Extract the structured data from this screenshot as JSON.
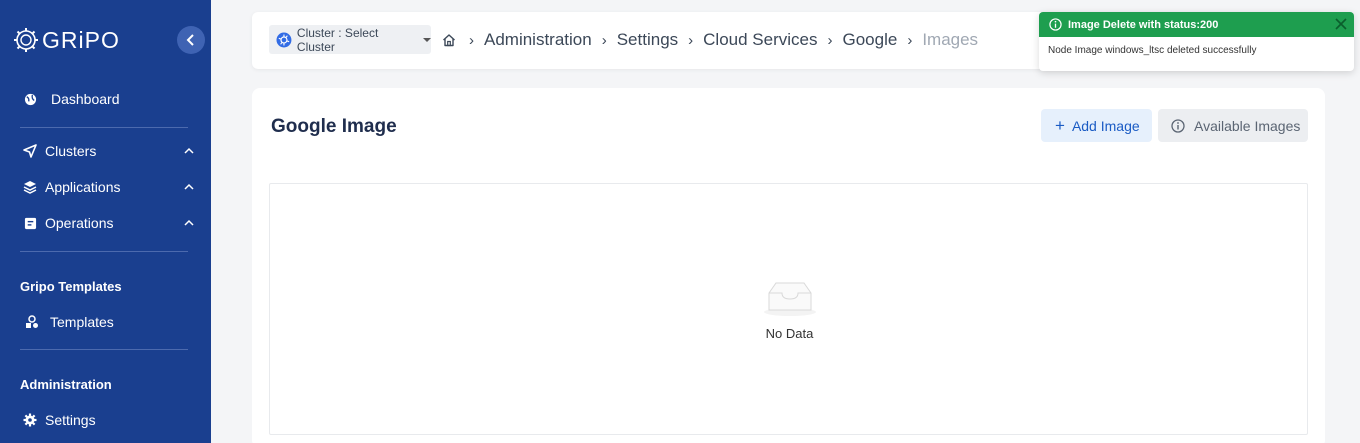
{
  "sidebar": {
    "logo_text": "GRiPO",
    "items": [
      {
        "label": "Dashboard",
        "icon": "globe-icon"
      },
      {
        "label": "Clusters",
        "icon": "send-icon"
      },
      {
        "label": "Applications",
        "icon": "layers-icon"
      },
      {
        "label": "Operations",
        "icon": "clipboard-icon"
      },
      {
        "label": "Templates",
        "icon": "shapes-icon"
      },
      {
        "label": "Settings",
        "icon": "gear-icon"
      }
    ],
    "sections": {
      "templates": "Gripo Templates",
      "administration": "Administration"
    }
  },
  "topbar": {
    "cluster_select": "Cluster : Select Cluster",
    "breadcrumbs": [
      "Administration",
      "Settings",
      "Cloud Services",
      "Google",
      "Images"
    ]
  },
  "main": {
    "title": "Google Image",
    "add_button": "Add Image",
    "available_button": "Available Images",
    "empty_text": "No Data"
  },
  "toast": {
    "title": "Image Delete with status:200",
    "message": "Node Image windows_ltsc deleted successfully"
  },
  "colors": {
    "sidebar": "#1a3f8f",
    "accent": "#1a5bc4",
    "success": "#1e9e4f"
  }
}
